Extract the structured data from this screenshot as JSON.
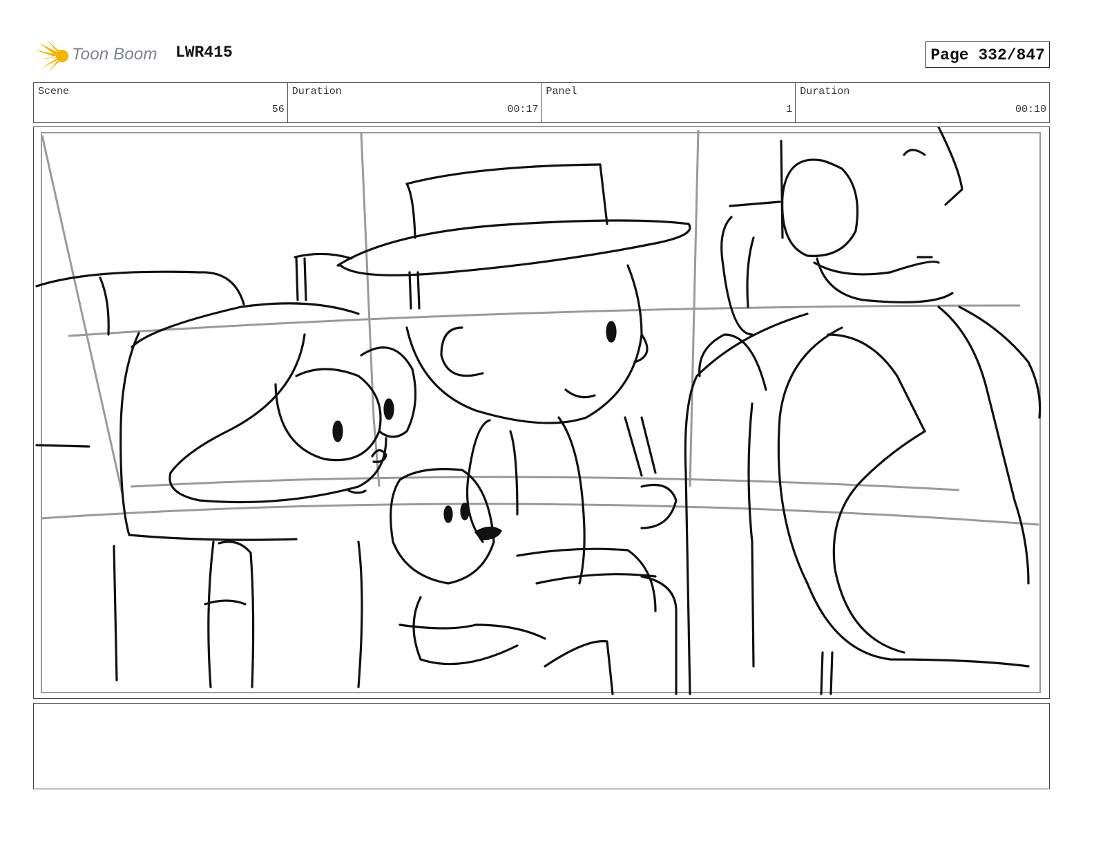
{
  "header": {
    "logo_text": "Toon Boom",
    "project_code": "LWR415",
    "page_label": "Page 332/847"
  },
  "info_bar": {
    "scene_label": "Scene",
    "scene_value": "56",
    "scene_duration_label": "Duration",
    "scene_duration_value": "00:17",
    "panel_label": "Panel",
    "panel_value": "1",
    "panel_duration_label": "Duration",
    "panel_duration_value": "00:10"
  },
  "panel": {
    "image_kind": "storyboard-sketch"
  },
  "notes": {
    "text": ""
  },
  "colors": {
    "logo_accent": "#f4b400",
    "logo_text": "#7d8289",
    "ink": "#111111",
    "guide_lines": "#9a9a9a"
  }
}
